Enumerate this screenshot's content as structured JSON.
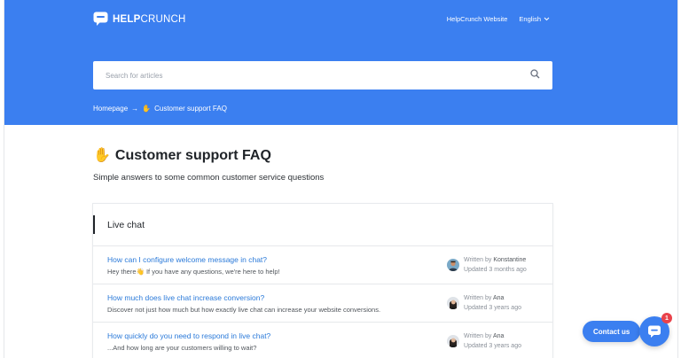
{
  "brand": {
    "bold": "HELP",
    "light": "CRUNCH"
  },
  "topnav": {
    "website": "HelpCrunch Website",
    "language": "English"
  },
  "search": {
    "placeholder": "Search for articles"
  },
  "breadcrumb": {
    "home": "Homepage",
    "arrow": "→",
    "emoji": "✋",
    "current": "Customer support FAQ"
  },
  "page": {
    "emoji": "✋",
    "title": "Customer support FAQ",
    "subtitle": "Simple answers to some common customer service questions"
  },
  "section": {
    "title": "Live chat"
  },
  "articles": [
    {
      "question": "How can I configure welcome message in chat?",
      "excerpt": "Hey there👋 If you have any questions, we're here to help!",
      "written_by": "Written by",
      "author": "Konstantine",
      "updated": "Updated 3 months ago"
    },
    {
      "question": "How much does live chat increase conversion?",
      "excerpt": "Discover not just how much but how exactly live chat can increase your website conversions.",
      "written_by": "Written by",
      "author": "Ana",
      "updated": "Updated 3 years ago"
    },
    {
      "question": "How quickly do you need to respond in live chat?",
      "excerpt": "...And how long are your customers willing to wait?",
      "written_by": "Written by",
      "author": "Ana",
      "updated": "Updated 3 years ago"
    }
  ],
  "widget": {
    "contact_label": "Contact us",
    "badge_count": "1"
  },
  "colors": {
    "brand_blue": "#3b7ff0",
    "link_blue": "#2b7ad9",
    "badge_red": "#e9424b"
  },
  "icons": {
    "logo": "chat-bubble-logo-icon",
    "search": "search-icon",
    "chevron": "chevron-down-icon",
    "chat": "chat-icon"
  }
}
